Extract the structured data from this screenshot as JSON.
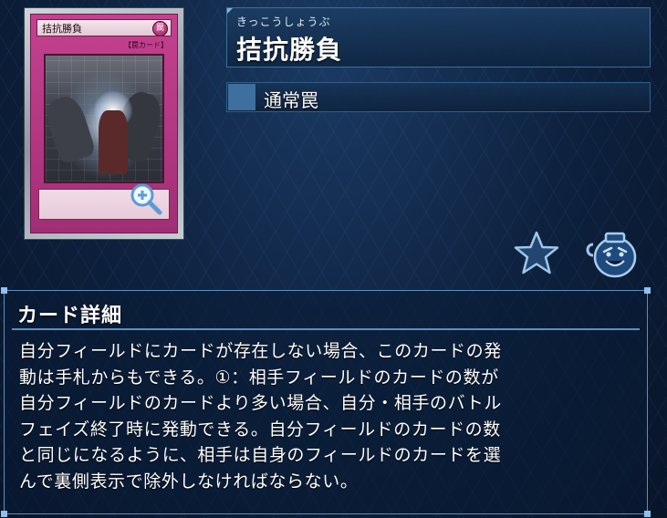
{
  "card": {
    "ruby": "きっこうしょうぶ",
    "name": "拮抗勝負",
    "type": "通常罠",
    "thumbnail": {
      "name": "拮抗勝負",
      "attribute": "罠",
      "type_line": "【罠カード】"
    }
  },
  "details": {
    "title": "カード詳細",
    "lines": [
      "自分フィールドにカードが存在しない場合、このカードの発",
      "動は手札からもできる。①：相手フィールドのカードの数が",
      "自分フィールドのカードより多い場合、自分・相手のバトル",
      "フェイズ終了時に発動できる。自分フィールドのカードの数",
      "と同じになるように、相手は自身のフィールドのカードを選",
      "んで裏側表示で除外しなければならない。"
    ]
  },
  "icons": {
    "zoom": "zoom-in-icon",
    "favorite": "star-icon",
    "pot": "pot-icon"
  },
  "colors": {
    "trap_frame": "#b13680",
    "panel_border": "#5d8fc0",
    "background": "#0c1f3a"
  }
}
